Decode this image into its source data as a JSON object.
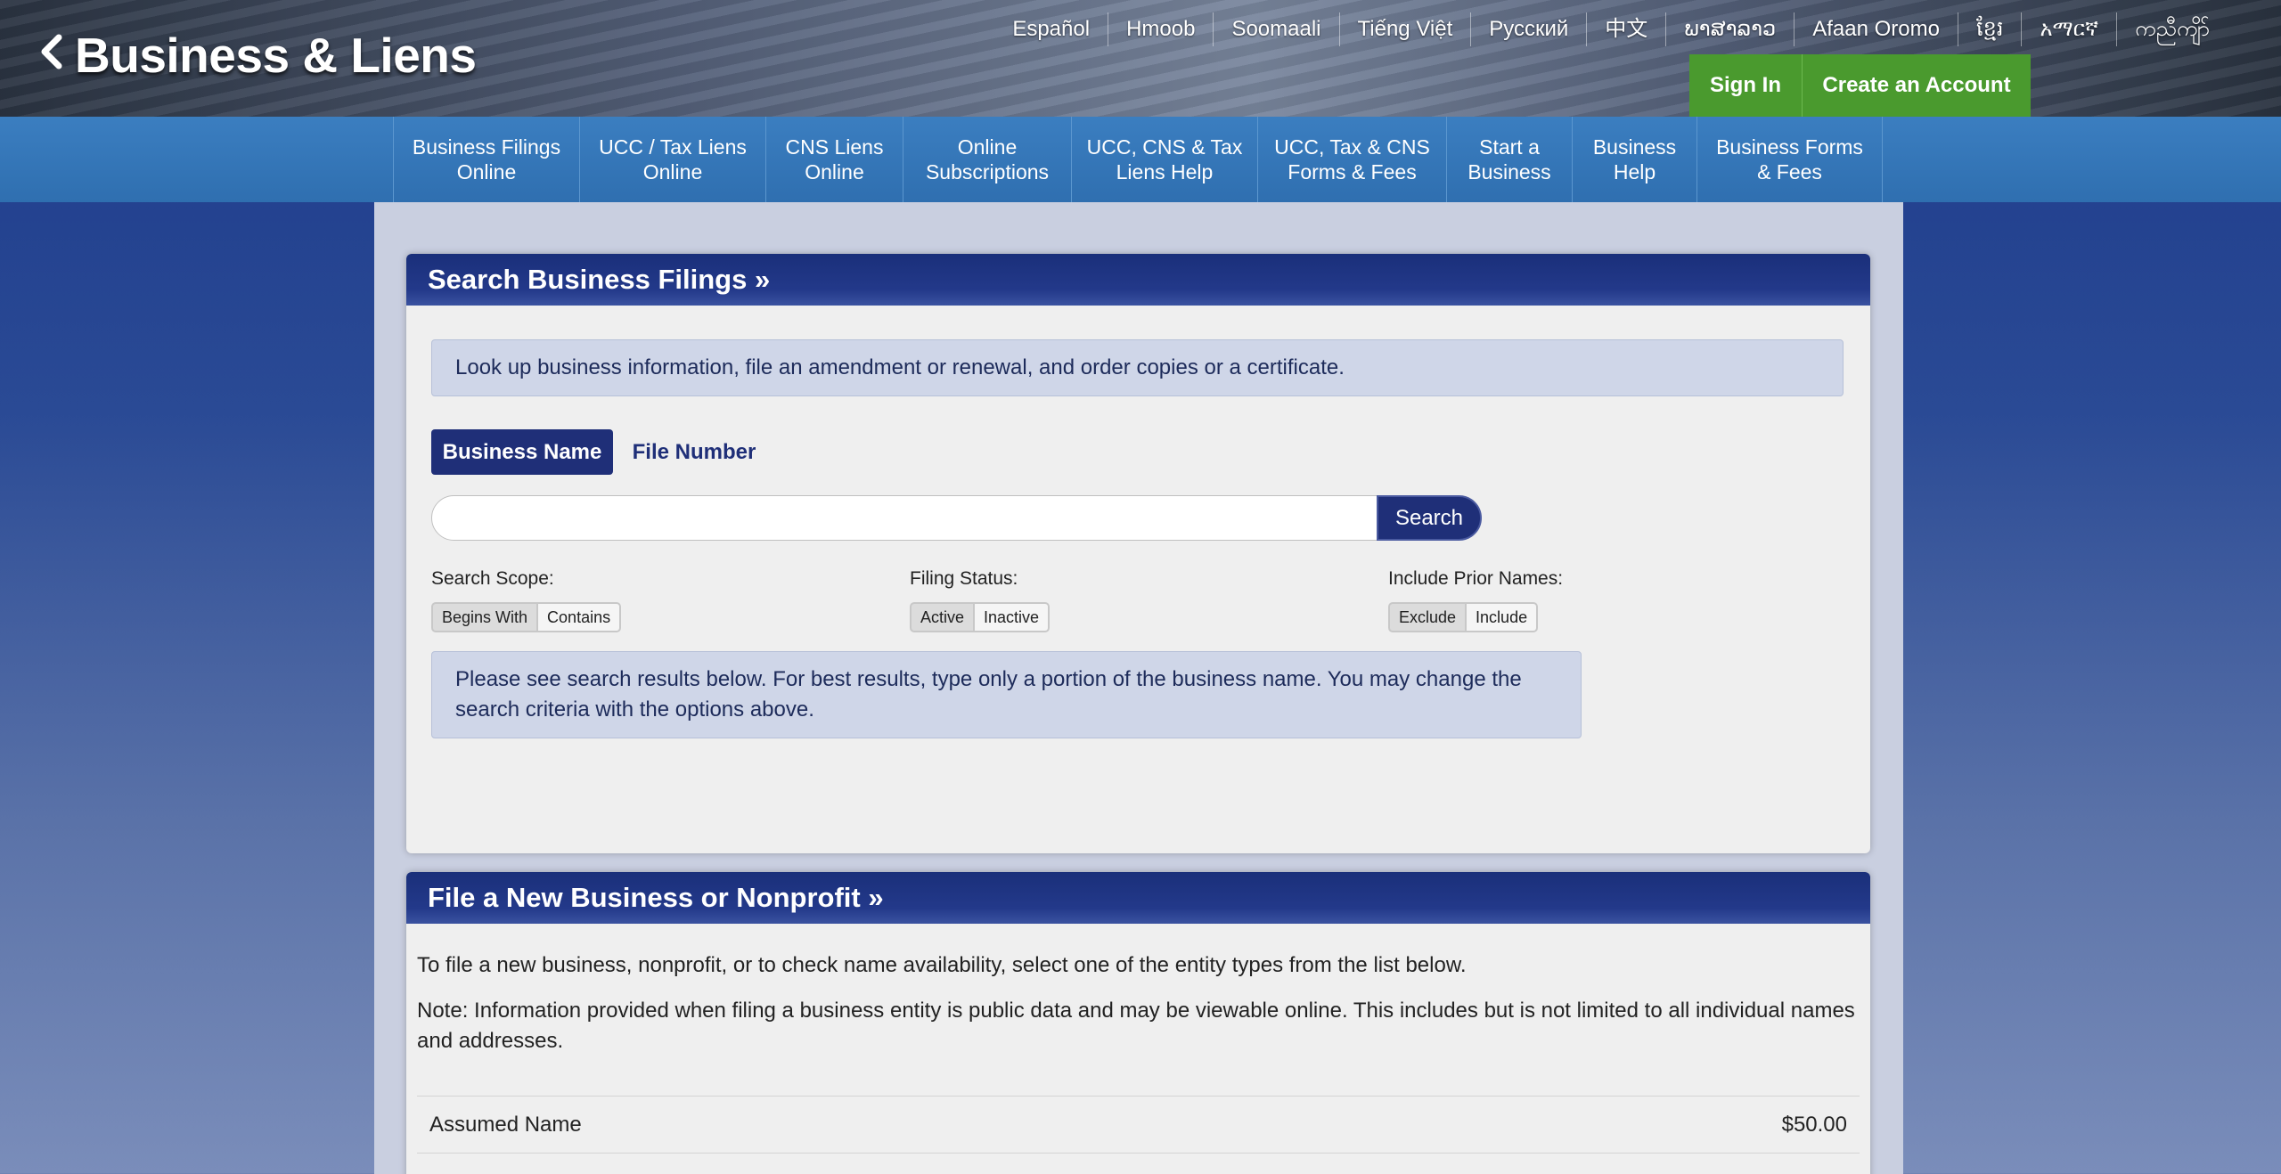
{
  "header": {
    "site_title": "Business & Liens",
    "languages": [
      "Español",
      "Hmoob",
      "Soomaali",
      "Tiếng Việt",
      "Русский",
      "中文",
      "ພາສາລາວ",
      "Afaan Oromo",
      "ខ្មែរ",
      "አማርኛ",
      "ကညီကျိာ်"
    ],
    "sign_in": "Sign In",
    "create_account": "Create an Account"
  },
  "nav": {
    "items": [
      {
        "line1": "Business Filings",
        "line2": "Online"
      },
      {
        "line1": "UCC / Tax Liens",
        "line2": "Online"
      },
      {
        "line1": "CNS Liens",
        "line2": "Online"
      },
      {
        "line1": "Online",
        "line2": "Subscriptions"
      },
      {
        "line1": "UCC, CNS & Tax",
        "line2": "Liens Help"
      },
      {
        "line1": "UCC, Tax & CNS",
        "line2": "Forms & Fees"
      },
      {
        "line1": "Start a",
        "line2": "Business"
      },
      {
        "line1": "Business",
        "line2": "Help"
      },
      {
        "line1": "Business Forms",
        "line2": "& Fees"
      }
    ]
  },
  "search_panel": {
    "title": "Search Business Filings »",
    "intro": "Look up business information, file an amendment or renewal, and order copies or a certificate.",
    "tab_active": "Business Name",
    "tab_inactive": "File Number",
    "search_value": "",
    "search_button": "Search",
    "filters": {
      "scope": {
        "label": "Search Scope:",
        "on": "Begins With",
        "off": "Contains"
      },
      "status": {
        "label": "Filing Status:",
        "on": "Active",
        "off": "Inactive"
      },
      "prior": {
        "label": "Include Prior Names:",
        "on": "Exclude",
        "off": "Include"
      }
    },
    "notice": "Please see search results below. For best results, type only a portion of the business name. You may change the search criteria with the options above."
  },
  "file_panel": {
    "title": "File a New Business or Nonprofit »",
    "text1": "To file a new business, nonprofit, or to check name availability, select one of the entity types from the list below.",
    "text2": "Note: Information provided when filing a business entity is public data and may be viewable online. This includes but is not limited to all individual names and addresses.",
    "rows": [
      {
        "name": "Assumed Name",
        "fee": "$50.00"
      },
      {
        "name": "",
        "fee": ""
      }
    ]
  },
  "colors": {
    "header_green": "#4a9a2e",
    "nav_blue": "#3377b8",
    "panel_head_navy": "#1f2f78"
  }
}
